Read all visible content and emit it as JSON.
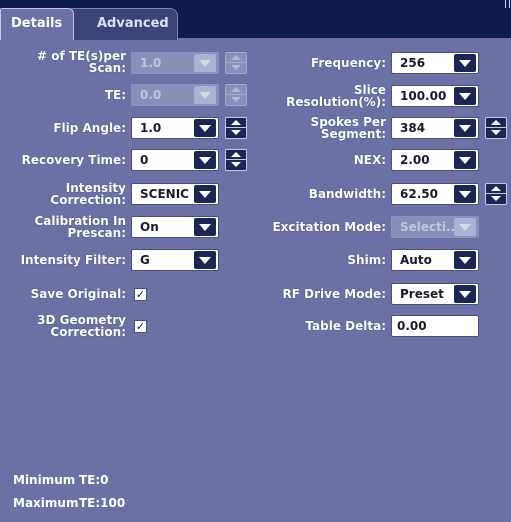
{
  "tabs": {
    "details": "Details",
    "advanced": "Advanced"
  },
  "left": {
    "te_per_scan": {
      "label1": "# of TE(s)per",
      "label2": "Scan:",
      "value": "1.0"
    },
    "te": {
      "label": "TE:",
      "value": "0.0"
    },
    "flip_angle": {
      "label": "Flip Angle:",
      "value": "1.0"
    },
    "recovery_time": {
      "label": "Recovery Time:",
      "value": "0"
    },
    "intensity_correction": {
      "label1": "Intensity",
      "label2": "Correction:",
      "value": "SCENIC"
    },
    "calibration_in_prescan": {
      "label1": "Calibration In",
      "label2": "Prescan:",
      "value": "On"
    },
    "intensity_filter": {
      "label": "Intensity Filter:",
      "value": "G"
    },
    "save_original": {
      "label": "Save Original:",
      "check": "✓"
    },
    "geometry_correction": {
      "label1": "3D Geometry",
      "label2": "Correction:",
      "check": "✓"
    }
  },
  "right": {
    "frequency": {
      "label": "Frequency:",
      "value": "256"
    },
    "slice_resolution": {
      "label1": "Slice",
      "label2": "Resolution(%):",
      "value": "100.00"
    },
    "spokes_per_segment": {
      "label1": "Spokes Per",
      "label2": "Segment:",
      "value": "384"
    },
    "nex": {
      "label": "NEX:",
      "value": "2.00"
    },
    "bandwidth": {
      "label": "Bandwidth:",
      "value": "62.50"
    },
    "excitation_mode": {
      "label": "Excitation Mode:",
      "value": "Selecti..."
    },
    "shim": {
      "label": "Shim:",
      "value": "Auto"
    },
    "rf_drive_mode": {
      "label": "RF Drive Mode:",
      "value": "Preset"
    },
    "table_delta": {
      "label": "Table Delta:",
      "value": "0.00"
    }
  },
  "footer": {
    "minimum": {
      "label": "Minimum",
      "value": "TE:0"
    },
    "maximum": {
      "label": "Maximum",
      "value": "TE:100"
    }
  },
  "colors": {
    "panel": "#6c70a4",
    "header": "#101d4c",
    "button": "#1c2654"
  }
}
